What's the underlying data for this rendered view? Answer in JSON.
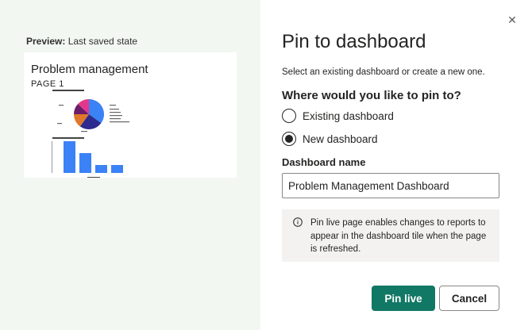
{
  "preview": {
    "label_bold": "Preview:",
    "label_rest": " Last saved state",
    "card": {
      "title": "Problem management",
      "page": "PAGE 1",
      "pie_chart": {
        "type": "pie",
        "slices": [
          {
            "value": 35,
            "color": "#3b82f6"
          },
          {
            "value": 25,
            "color": "#2e2a8f"
          },
          {
            "value": 15,
            "color": "#e0772b"
          },
          {
            "value": 12,
            "color": "#6b1d6b"
          },
          {
            "value": 13,
            "color": "#e5378a"
          }
        ]
      },
      "bar_chart": {
        "type": "bar",
        "values": [
          40,
          25,
          10,
          10
        ],
        "color": "#3b82f6",
        "ylim": [
          0,
          40
        ]
      }
    }
  },
  "dialog": {
    "close_glyph": "✕",
    "title": "Pin to dashboard",
    "subtitle": "Select an existing dashboard or create a new one.",
    "question": "Where would you like to pin to?",
    "options": [
      {
        "label": "Existing dashboard",
        "selected": false
      },
      {
        "label": "New dashboard",
        "selected": true
      }
    ],
    "dashboard_name_label": "Dashboard name",
    "dashboard_name_value": "Problem Management Dashboard",
    "info_text": "Pin live page enables changes to reports to appear in the dashboard tile when the page is refreshed.",
    "primary_button": "Pin live",
    "secondary_button": "Cancel",
    "accent_color": "#117865"
  }
}
